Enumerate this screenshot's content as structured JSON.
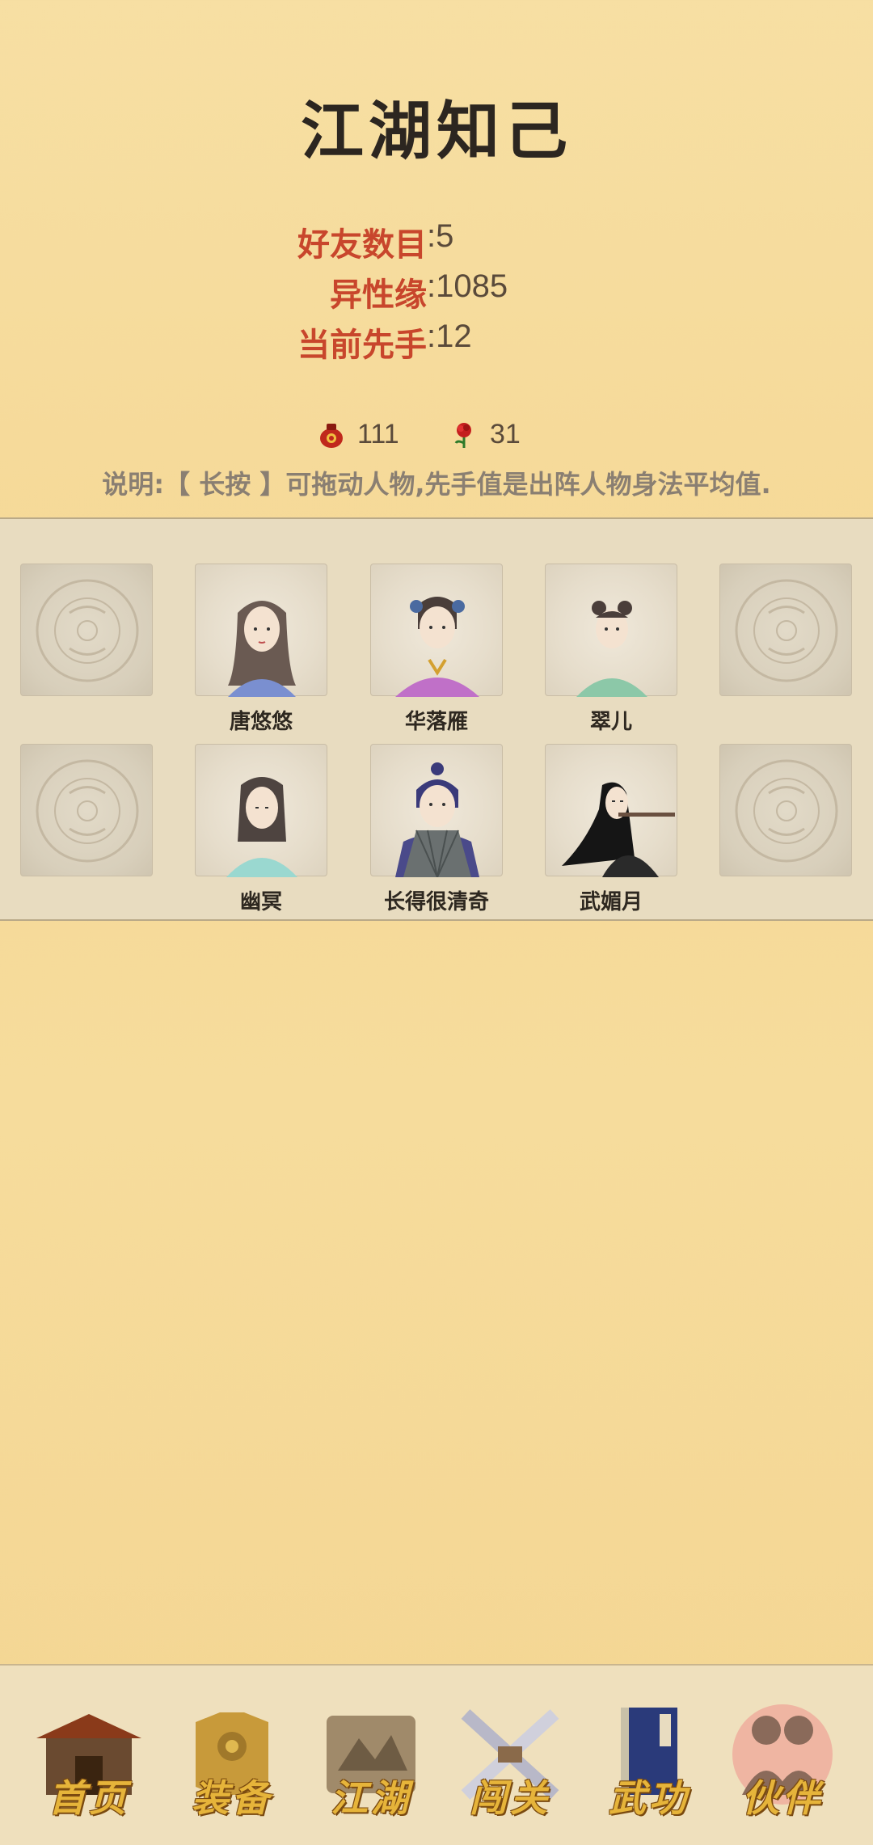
{
  "title": "江湖知己",
  "stats": [
    {
      "label": "好友数目",
      "value": "5"
    },
    {
      "label": "异性缘",
      "value": "1085"
    },
    {
      "label": "当前先手",
      "value": "12"
    }
  ],
  "resources": {
    "wine": {
      "icon": "wine-jar-icon",
      "value": "111"
    },
    "rose": {
      "icon": "rose-icon",
      "value": "31"
    }
  },
  "note": "说明:【 长按 】可拖动人物,先手值是出阵人物身法平均值.",
  "characters_row1": [
    {
      "name": "唐悠悠"
    },
    {
      "name": "华落雁"
    },
    {
      "name": "翠儿"
    }
  ],
  "characters_row2": [
    {
      "name": "幽冥"
    },
    {
      "name": "长得很清奇"
    },
    {
      "name": "武媚月"
    }
  ],
  "nav": [
    {
      "label": "首页",
      "icon": "house-icon"
    },
    {
      "label": "装备",
      "icon": "armor-icon"
    },
    {
      "label": "江湖",
      "icon": "scroll-map-icon"
    },
    {
      "label": "闯关",
      "icon": "crossed-swords-icon"
    },
    {
      "label": "武功",
      "icon": "book-icon"
    },
    {
      "label": "伙伴",
      "icon": "partners-icon",
      "active": true
    }
  ],
  "colors": {
    "stat_label": "#c8462c",
    "nav_label": "#e6b43a",
    "background": "#f5d896"
  }
}
